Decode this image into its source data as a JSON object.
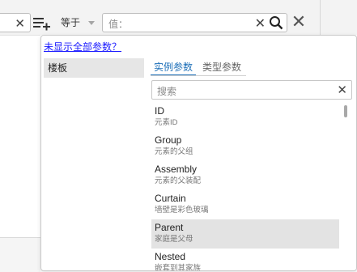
{
  "toolbar": {
    "operator": "等于",
    "value_placeholder": "值："
  },
  "popup": {
    "hidden_params_link": "未显示全部参数？",
    "categories": [
      "楼板"
    ],
    "tabs": [
      "实例参数",
      "类型参数"
    ],
    "search_placeholder": "搜索",
    "params": [
      {
        "name": "ID",
        "desc": "元素ID",
        "highlighted": false
      },
      {
        "name": "Group",
        "desc": "元素的父组",
        "highlighted": false
      },
      {
        "name": "Assembly",
        "desc": "元素的父装配",
        "highlighted": false
      },
      {
        "name": "Curtain",
        "desc": "墙壁是彩色玻璃",
        "highlighted": false
      },
      {
        "name": "Parent",
        "desc": "家庭是父母",
        "highlighted": true
      },
      {
        "name": "Nested",
        "desc": "嵌套到其家族",
        "highlighted": false
      }
    ]
  },
  "colors": {
    "accent": "#1d6fb8",
    "link": "#1a1aff",
    "highlight": "#e3e3e3"
  }
}
